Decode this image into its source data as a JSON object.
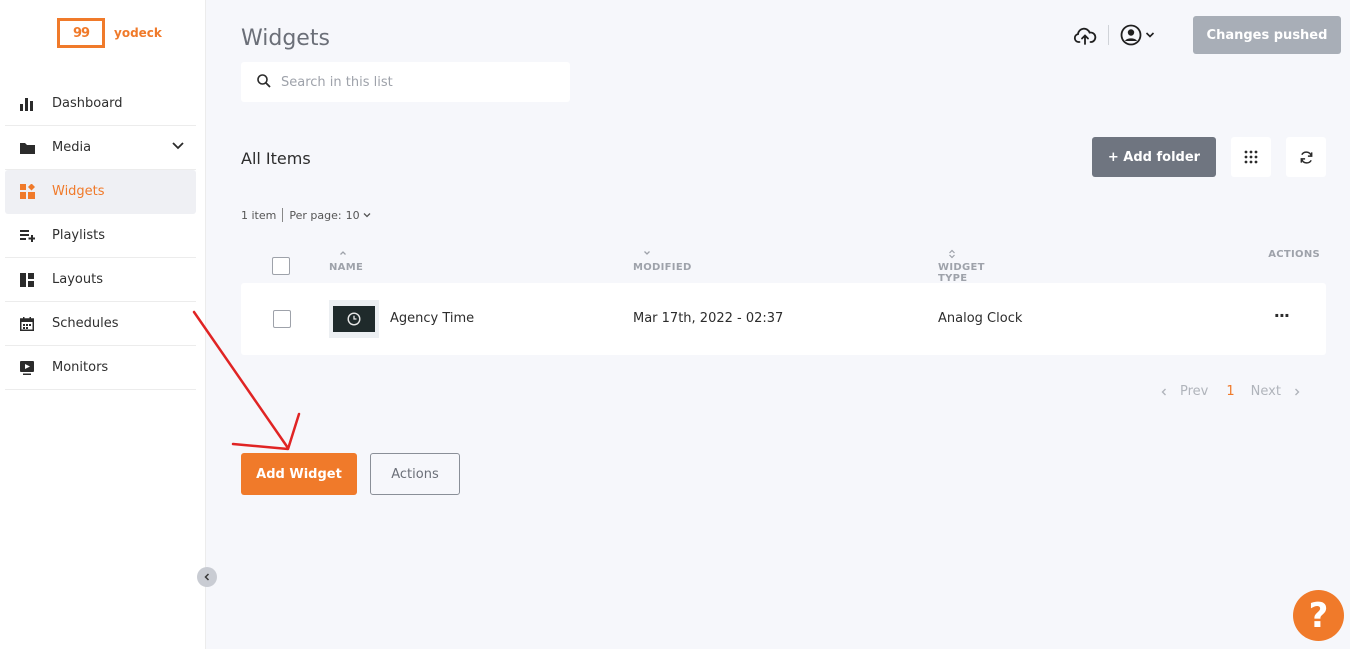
{
  "brand": {
    "name": "yodeck",
    "mark": "99",
    "accent": "#f07a2a"
  },
  "sidebar": {
    "items": [
      {
        "label": "Dashboard",
        "icon": "bar-chart-icon"
      },
      {
        "label": "Media",
        "icon": "folder-icon"
      },
      {
        "label": "Widgets",
        "icon": "widgets-icon"
      },
      {
        "label": "Playlists",
        "icon": "playlist-add-icon"
      },
      {
        "label": "Layouts",
        "icon": "layout-icon"
      },
      {
        "label": "Schedules",
        "icon": "calendar-icon"
      },
      {
        "label": "Monitors",
        "icon": "monitor-play-icon"
      }
    ],
    "active": "Widgets"
  },
  "header": {
    "title": "Widgets",
    "search_placeholder": "Search in this list",
    "changes_label": "Changes pushed"
  },
  "list": {
    "section_title": "All Items",
    "add_folder_label": "+ Add folder",
    "count_text": "1 item",
    "per_page_label": "Per page:",
    "per_page_value": "10",
    "columns": {
      "name": "NAME",
      "modified": "MODIFIED",
      "type": "WIDGET TYPE",
      "actions": "ACTIONS"
    },
    "rows": [
      {
        "name": "Agency Time",
        "modified": "Mar 17th, 2022 - 02:37",
        "type": "Analog Clock",
        "actions": "···"
      }
    ]
  },
  "pagination": {
    "prev": "Prev",
    "current": "1",
    "next": "Next"
  },
  "footer": {
    "add_widget_label": "Add Widget",
    "actions_label": "Actions"
  },
  "help": {
    "label": "?"
  }
}
